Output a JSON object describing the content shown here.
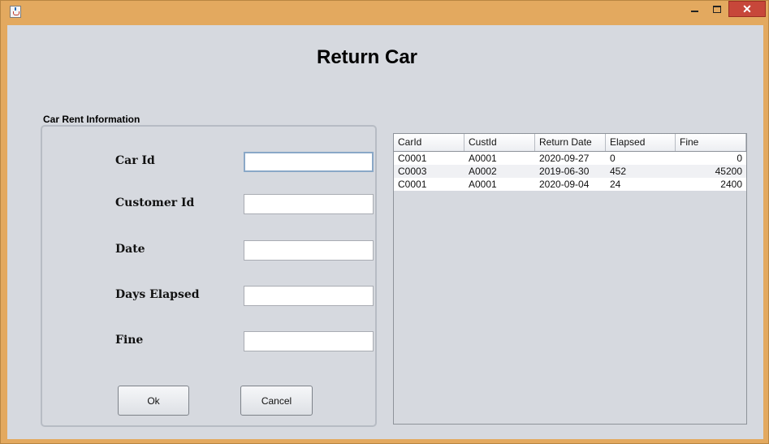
{
  "window": {
    "close_glyph": "✕"
  },
  "page": {
    "title": "Return Car"
  },
  "form": {
    "caption": "Car Rent Information",
    "fields": [
      {
        "label": "Car Id",
        "value": ""
      },
      {
        "label": "Customer Id",
        "value": ""
      },
      {
        "label": "Date",
        "value": ""
      },
      {
        "label": "Days Elapsed",
        "value": ""
      },
      {
        "label": "Fine",
        "value": ""
      }
    ],
    "ok_label": "Ok",
    "cancel_label": "Cancel"
  },
  "table": {
    "columns": [
      "CarId",
      "CustId",
      "Return Date",
      "Elapsed",
      "Fine"
    ],
    "rows": [
      [
        "C0001",
        "A0001",
        "2020-09-27",
        "0",
        "0"
      ],
      [
        "C0003",
        "A0002",
        "2019-06-30",
        "452",
        "45200"
      ],
      [
        "C0001",
        "A0001",
        "2020-09-04",
        "24",
        "2400"
      ]
    ]
  },
  "colors": {
    "frame": "#e3a95f",
    "close_button": "#c7473a",
    "client_background": "#d6d9df"
  }
}
